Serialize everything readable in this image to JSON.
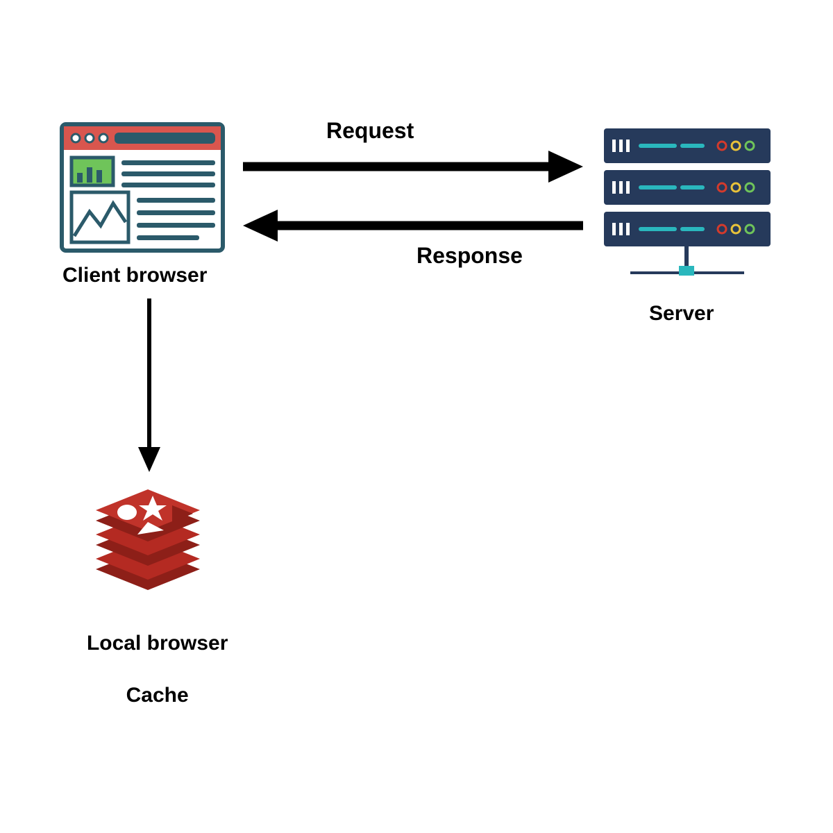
{
  "labels": {
    "request": "Request",
    "response": "Response",
    "client": "Client browser",
    "server": "Server",
    "cache_line1": "Local browser",
    "cache_line2": "Cache"
  },
  "colors": {
    "arrow": "#000000",
    "text": "#000000",
    "browser_frame": "#2b5a6a",
    "browser_header": "#d9564e",
    "browser_chart": "#6fc45a",
    "server_body": "#263a5b",
    "server_bar": "#2ab7bd",
    "led_red": "#d33a2c",
    "led_yellow": "#e8c23a",
    "led_green": "#6fc45a",
    "cache_red": "#b42a22",
    "cache_red_dark": "#8d1f18",
    "cache_white": "#ffffff"
  }
}
